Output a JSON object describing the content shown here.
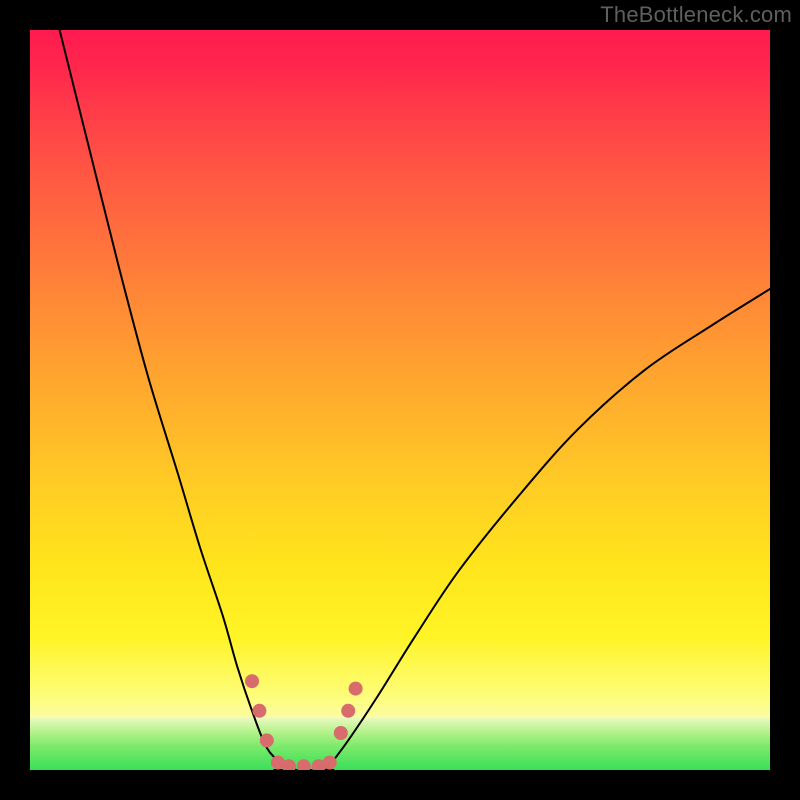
{
  "watermark": "TheBottleneck.com",
  "chart_data": {
    "type": "line",
    "title": "",
    "xlabel": "",
    "ylabel": "",
    "xlim": [
      0,
      100
    ],
    "ylim": [
      0,
      100
    ],
    "grid": false,
    "legend": false,
    "notes": "Bottleneck-style V-curve. Background is a vertical gradient: red (top) → orange → yellow → pale yellow, with a thin green band along the very bottom (~y≤7). Two black curves descend from the top-left and top-right into a flat trough near x≈33–40, y≈0. Salmon-colored dots mark the curve near the trough.",
    "series": [
      {
        "name": "left-curve",
        "x": [
          4,
          8,
          12,
          16,
          20,
          23,
          26,
          28,
          30,
          32,
          34,
          36
        ],
        "y": [
          100,
          84,
          68,
          53,
          40,
          30,
          21,
          14,
          8,
          3,
          1,
          0
        ]
      },
      {
        "name": "trough",
        "x": [
          33,
          35,
          37,
          39,
          41
        ],
        "y": [
          0,
          0,
          0,
          0,
          0
        ]
      },
      {
        "name": "right-curve",
        "x": [
          40,
          43,
          47,
          52,
          58,
          66,
          74,
          83,
          92,
          100
        ],
        "y": [
          0,
          4,
          10,
          18,
          27,
          37,
          46,
          54,
          60,
          65
        ]
      }
    ],
    "dots": {
      "name": "trough-markers",
      "color": "#d86b6b",
      "radius_px": 7,
      "points": [
        {
          "x": 30,
          "y": 12
        },
        {
          "x": 31,
          "y": 8
        },
        {
          "x": 32,
          "y": 4
        },
        {
          "x": 33.5,
          "y": 1
        },
        {
          "x": 35,
          "y": 0.5
        },
        {
          "x": 37,
          "y": 0.5
        },
        {
          "x": 39,
          "y": 0.5
        },
        {
          "x": 40.5,
          "y": 1
        },
        {
          "x": 42,
          "y": 5
        },
        {
          "x": 43,
          "y": 8
        },
        {
          "x": 44,
          "y": 11
        }
      ]
    },
    "background_gradient": {
      "type": "vertical",
      "stops": [
        {
          "pos": 0.0,
          "color": "#ff1a4f"
        },
        {
          "pos": 0.5,
          "color": "#ffa82e"
        },
        {
          "pos": 0.9,
          "color": "#fdfd7a"
        },
        {
          "pos": 1.0,
          "color": "#eef8c6"
        }
      ],
      "bottom_band": {
        "from_y": 0,
        "to_y": 7,
        "colors": [
          "#e9f9c0",
          "#39e05a"
        ]
      }
    }
  }
}
